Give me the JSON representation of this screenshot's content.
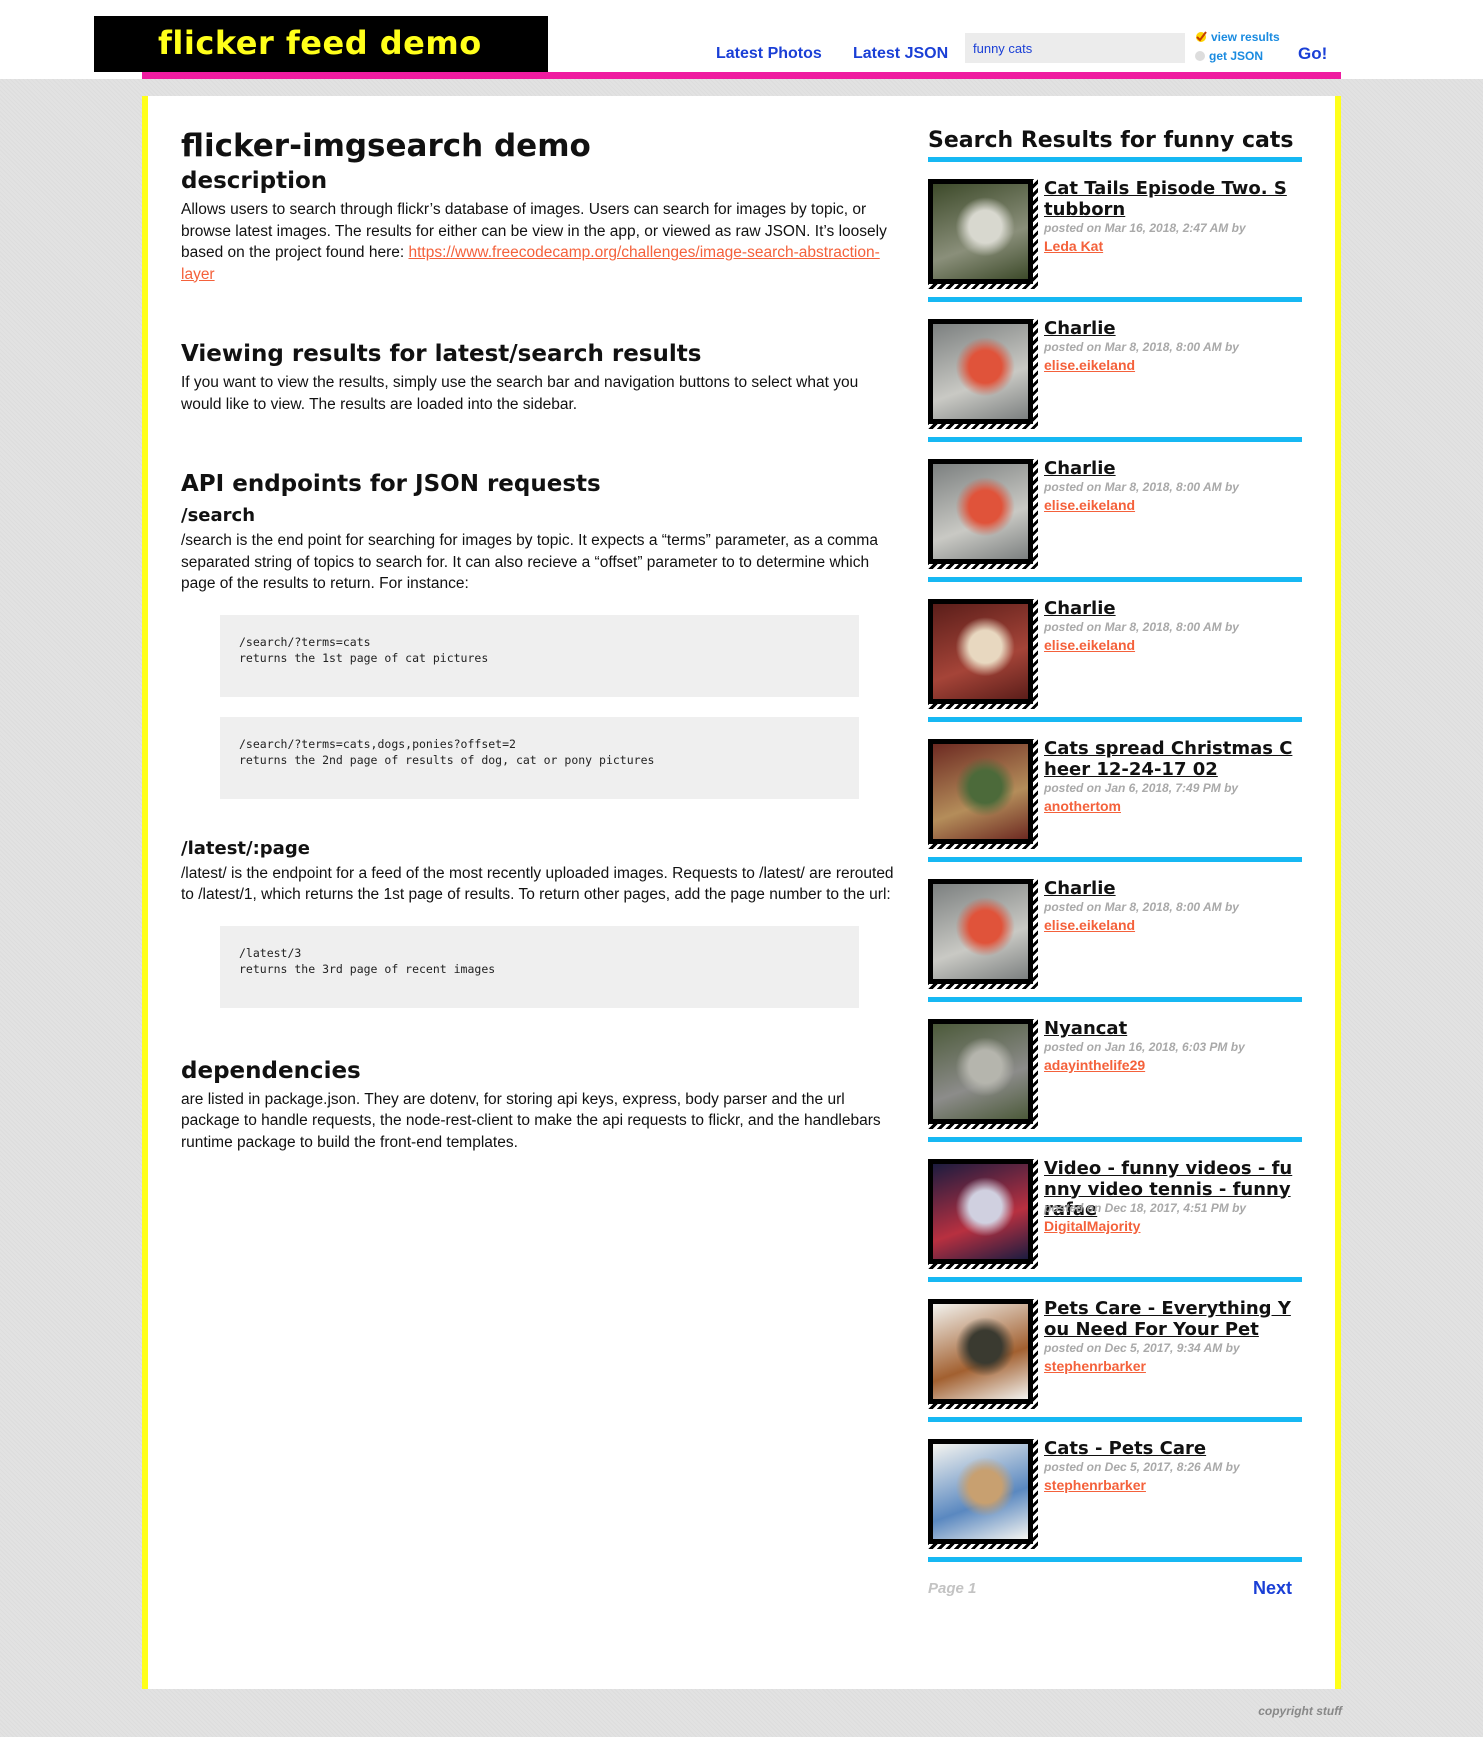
{
  "header": {
    "logo": "flicker feed demo",
    "nav": [
      {
        "label": "Latest Photos"
      },
      {
        "label": "Latest JSON"
      }
    ],
    "search": {
      "value": "funny cats",
      "placeholder": ""
    },
    "options": {
      "view_label": "view results",
      "json_label": "get JSON",
      "selected": "view results"
    },
    "go_label": "Go!"
  },
  "colors": {
    "accent_pink": "#ef1ba0",
    "accent_yellow": "#ffff1a",
    "accent_blue": "#16b8f3",
    "link_blue": "#1a3fd6",
    "author_orange": "#f4613b"
  },
  "content": {
    "title": "flicker-imgsearch demo",
    "description_heading": "description",
    "description_text": "Allows users to search through flickr’s database of images. Users can search for images by topic, or browse latest images. The results for either can be view in the app, or viewed as raw JSON. It’s loosely based on the project found here: ",
    "description_link": "https://www.freecodecamp.org/challenges/image-search-abstraction-layer",
    "viewing_heading": "Viewing results for latest/search results",
    "viewing_text": "If you want to view the results, simply use the search bar and navigation buttons to select what you would like to view. The results are loaded into the sidebar.",
    "api_heading": "API endpoints for JSON requests",
    "search_heading": "/search",
    "search_text": "/search is the end point for searching for images by topic. It expects a “terms” parameter, as a comma separated string of topics to search for. It can also recieve a “offset” parameter to to determine which page of the results to return. For instance:",
    "search_code_1": "/search/?terms=cats\nreturns the 1st page of cat pictures",
    "search_code_2": "/search/?terms=cats,dogs,ponies?offset=2\nreturns the 2nd page of results of dog, cat or pony pictures",
    "latest_heading": "/latest/:page",
    "latest_text": "/latest/ is the endpoint for a feed of the most recently uploaded images. Requests to /latest/ are rerouted to /latest/1, which returns the 1st page of results. To return other pages, add the page number to the url:",
    "latest_code": "/latest/3\nreturns the 3rd page of recent images",
    "dependencies_heading": "dependencies",
    "dependencies_text": "are listed in package.json. They are dotenv, for storing api keys, express, body parser and the url package to handle requests, the node-rest-client to make the api requests to flickr, and the handlebars runtime package to build the front-end templates."
  },
  "sidebar": {
    "title": "Search Results for funny cats",
    "results": [
      {
        "title": "Cat Tails Episode Two. Stubborn",
        "meta": "posted on Mar 16, 2018, 2:47 AM by",
        "author": "Leda Kat",
        "thumb_colors": [
          "#3d4a2a",
          "#8a8f7a",
          "#d8d8cf"
        ]
      },
      {
        "title": "Charlie",
        "meta": "posted on Mar 8, 2018, 8:00 AM by",
        "author": "elise.eikeland",
        "thumb_colors": [
          "#7c8080",
          "#c9c9c4",
          "#e0533a"
        ]
      },
      {
        "title": "Charlie",
        "meta": "posted on Mar 8, 2018, 8:00 AM by",
        "author": "elise.eikeland",
        "thumb_colors": [
          "#7c8080",
          "#c9c9c4",
          "#e0533a"
        ]
      },
      {
        "title": "Charlie",
        "meta": "posted on Mar 8, 2018, 8:00 AM by",
        "author": "elise.eikeland",
        "thumb_colors": [
          "#5b1e1a",
          "#a54438",
          "#e8d8c0"
        ]
      },
      {
        "title": "Cats spread Christmas Cheer 12-24-17 02",
        "meta": "posted on Jan 6, 2018, 7:49 PM by",
        "author": "anothertom",
        "thumb_colors": [
          "#6d2a22",
          "#b48d5a",
          "#4c6a3a"
        ]
      },
      {
        "title": "Charlie",
        "meta": "posted on Mar 8, 2018, 8:00 AM by",
        "author": "elise.eikeland",
        "thumb_colors": [
          "#7c8080",
          "#c9c9c4",
          "#e0533a"
        ]
      },
      {
        "title": "Nyancat",
        "meta": "posted on Jan 16, 2018, 6:03 PM by",
        "author": "adayinthelife29",
        "thumb_colors": [
          "#4c5a3a",
          "#8c8c8a",
          "#b5b5ad"
        ]
      },
      {
        "title": "Video - funny videos - funny video tennis - funny rafae",
        "meta": "posted on Dec 18, 2017, 4:51 PM by",
        "author": "DigitalMajority",
        "thumb_colors": [
          "#1c1c40",
          "#b83040",
          "#d0d0e0"
        ]
      },
      {
        "title": "Pets Care - Everything You Need For Your Pet",
        "meta": "posted on Dec 5, 2017, 9:34 AM by",
        "author": "stephenrbarker",
        "thumb_colors": [
          "#f2f2ee",
          "#a26030",
          "#3a3a30"
        ]
      },
      {
        "title": "Cats - Pets Care",
        "meta": "posted on Dec 5, 2017, 8:26 AM by",
        "author": "stephenrbarker",
        "thumb_colors": [
          "#f4f4f0",
          "#5a88c0",
          "#c8a070"
        ]
      }
    ],
    "pager": {
      "page_label": "Page 1",
      "next_label": "Next"
    }
  },
  "footer": {
    "copyright": "copyright stuff"
  }
}
